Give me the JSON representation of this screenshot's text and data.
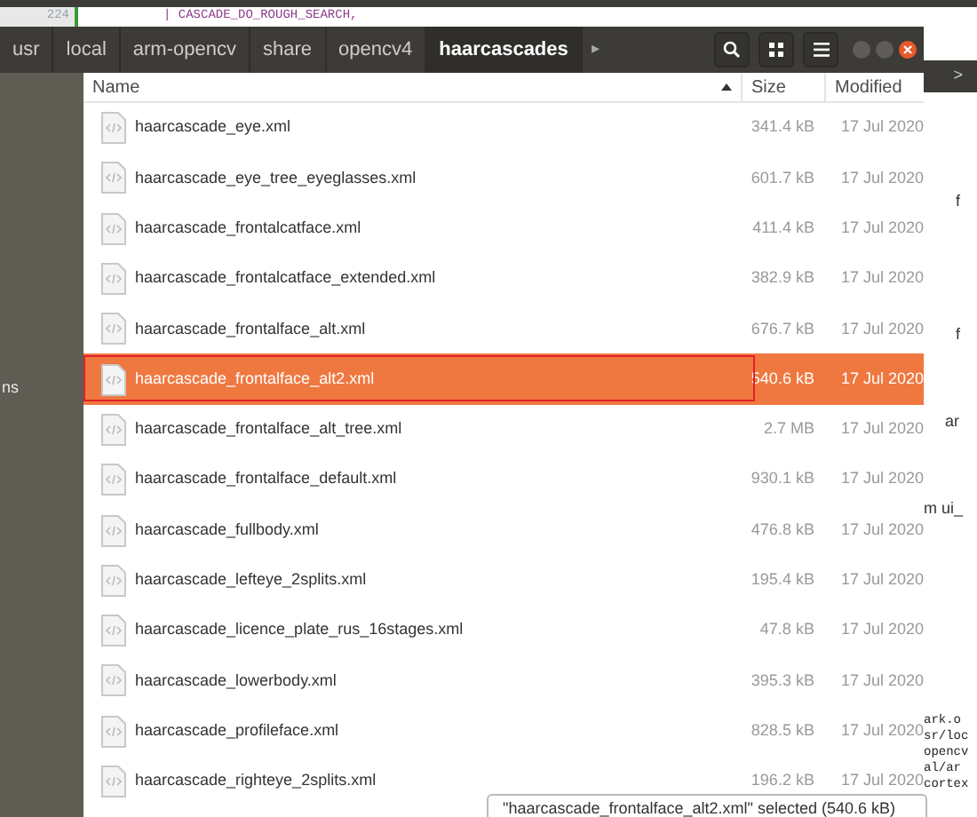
{
  "editor": {
    "line_number": "224",
    "code": "| CASCADE_DO_ROUGH_SEARCH,"
  },
  "breadcrumbs": [
    {
      "label": "usr",
      "selected": false
    },
    {
      "label": "local",
      "selected": false
    },
    {
      "label": "arm-opencv",
      "selected": false
    },
    {
      "label": "share",
      "selected": false
    },
    {
      "label": "opencv4",
      "selected": false
    },
    {
      "label": "haarcascades",
      "selected": true
    }
  ],
  "scroll_arrow": "▸",
  "columns": [
    {
      "label": "Name",
      "sorted": true
    },
    {
      "label": "Size",
      "sorted": false
    },
    {
      "label": "Modified",
      "sorted": false
    }
  ],
  "files": [
    {
      "name": "haarcascade_eye.xml",
      "size": "341.4 kB",
      "modified": "17 Jul 2020",
      "selected": false,
      "outlined": false
    },
    {
      "name": "haarcascade_eye_tree_eyeglasses.xml",
      "size": "601.7 kB",
      "modified": "17 Jul 2020",
      "selected": false,
      "outlined": false
    },
    {
      "name": "haarcascade_frontalcatface.xml",
      "size": "411.4 kB",
      "modified": "17 Jul 2020",
      "selected": false,
      "outlined": false
    },
    {
      "name": "haarcascade_frontalcatface_extended.xml",
      "size": "382.9 kB",
      "modified": "17 Jul 2020",
      "selected": false,
      "outlined": false
    },
    {
      "name": "haarcascade_frontalface_alt.xml",
      "size": "676.7 kB",
      "modified": "17 Jul 2020",
      "selected": false,
      "outlined": false
    },
    {
      "name": "haarcascade_frontalface_alt2.xml",
      "size": "540.6 kB",
      "modified": "17 Jul 2020",
      "selected": true,
      "outlined": true
    },
    {
      "name": "haarcascade_frontalface_alt_tree.xml",
      "size": "2.7 MB",
      "modified": "17 Jul 2020",
      "selected": false,
      "outlined": false
    },
    {
      "name": "haarcascade_frontalface_default.xml",
      "size": "930.1 kB",
      "modified": "17 Jul 2020",
      "selected": false,
      "outlined": false
    },
    {
      "name": "haarcascade_fullbody.xml",
      "size": "476.8 kB",
      "modified": "17 Jul 2020",
      "selected": false,
      "outlined": false
    },
    {
      "name": "haarcascade_lefteye_2splits.xml",
      "size": "195.4 kB",
      "modified": "17 Jul 2020",
      "selected": false,
      "outlined": false
    },
    {
      "name": "haarcascade_licence_plate_rus_16stages.xml",
      "size": "47.8 kB",
      "modified": "17 Jul 2020",
      "selected": false,
      "outlined": false
    },
    {
      "name": "haarcascade_lowerbody.xml",
      "size": "395.3 kB",
      "modified": "17 Jul 2020",
      "selected": false,
      "outlined": false
    },
    {
      "name": "haarcascade_profileface.xml",
      "size": "828.5 kB",
      "modified": "17 Jul 2020",
      "selected": false,
      "outlined": false
    },
    {
      "name": "haarcascade_righteye_2splits.xml",
      "size": "196.2 kB",
      "modified": "17 Jul 2020",
      "selected": false,
      "outlined": false
    }
  ],
  "status": "\"haarcascade_frontalface_alt2.xml\" selected (540.6 kB)",
  "sidebar_fragment": "ns",
  "background_window": {
    "tab_arrow": ">",
    "fragments": [
      "f",
      "f",
      "ar",
      "m ui_"
    ],
    "terminal_lines": [
      "ark.o",
      "sr/loc",
      "opencv",
      "al/ar",
      "cortex"
    ]
  }
}
